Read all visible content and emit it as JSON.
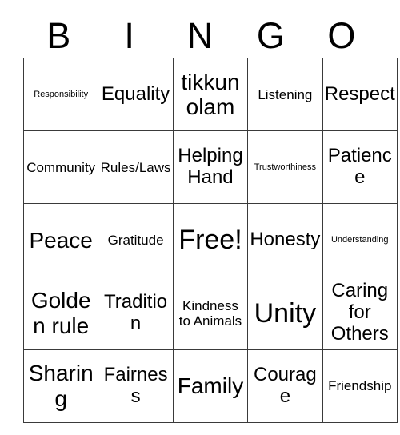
{
  "card": {
    "header_letters": [
      "B",
      "I",
      "N",
      "G",
      "O"
    ],
    "columns": 5,
    "rows": 5,
    "grid_line_color": "#3a3a3a",
    "background_color": "#ffffff",
    "text_color": "#000000",
    "cells": [
      [
        {
          "label": "Responsibility",
          "size": "fs-xs"
        },
        {
          "label": "Equality",
          "size": "fs-xl"
        },
        {
          "label": "tikkun olam",
          "size": "fs-xxl"
        },
        {
          "label": "Listening",
          "size": "fs-md"
        },
        {
          "label": "Respect",
          "size": "fs-xl"
        }
      ],
      [
        {
          "label": "Community",
          "size": "fs-md"
        },
        {
          "label": "Rules/Laws",
          "size": "fs-md"
        },
        {
          "label": "Helping Hand",
          "size": "fs-xl"
        },
        {
          "label": "Trustworthiness",
          "size": "fs-xs"
        },
        {
          "label": "Patience",
          "size": "fs-xl"
        }
      ],
      [
        {
          "label": "Peace",
          "size": "fs-xxl"
        },
        {
          "label": "Gratitude",
          "size": "fs-md"
        },
        {
          "label": "Free!",
          "size": "fs-huge"
        },
        {
          "label": "Honesty",
          "size": "fs-xl"
        },
        {
          "label": "Understanding",
          "size": "fs-xs"
        }
      ],
      [
        {
          "label": "Golden rule",
          "size": "fs-xxl"
        },
        {
          "label": "Tradition",
          "size": "fs-xl"
        },
        {
          "label": "Kindness to Animals",
          "size": "fs-md"
        },
        {
          "label": "Unity",
          "size": "fs-huge"
        },
        {
          "label": "Caring for Others",
          "size": "fs-xl"
        }
      ],
      [
        {
          "label": "Sharing",
          "size": "fs-xxl"
        },
        {
          "label": "Fairness",
          "size": "fs-xl"
        },
        {
          "label": "Family",
          "size": "fs-xxl"
        },
        {
          "label": "Courage",
          "size": "fs-xl"
        },
        {
          "label": "Friendship",
          "size": "fs-md"
        }
      ]
    ]
  }
}
